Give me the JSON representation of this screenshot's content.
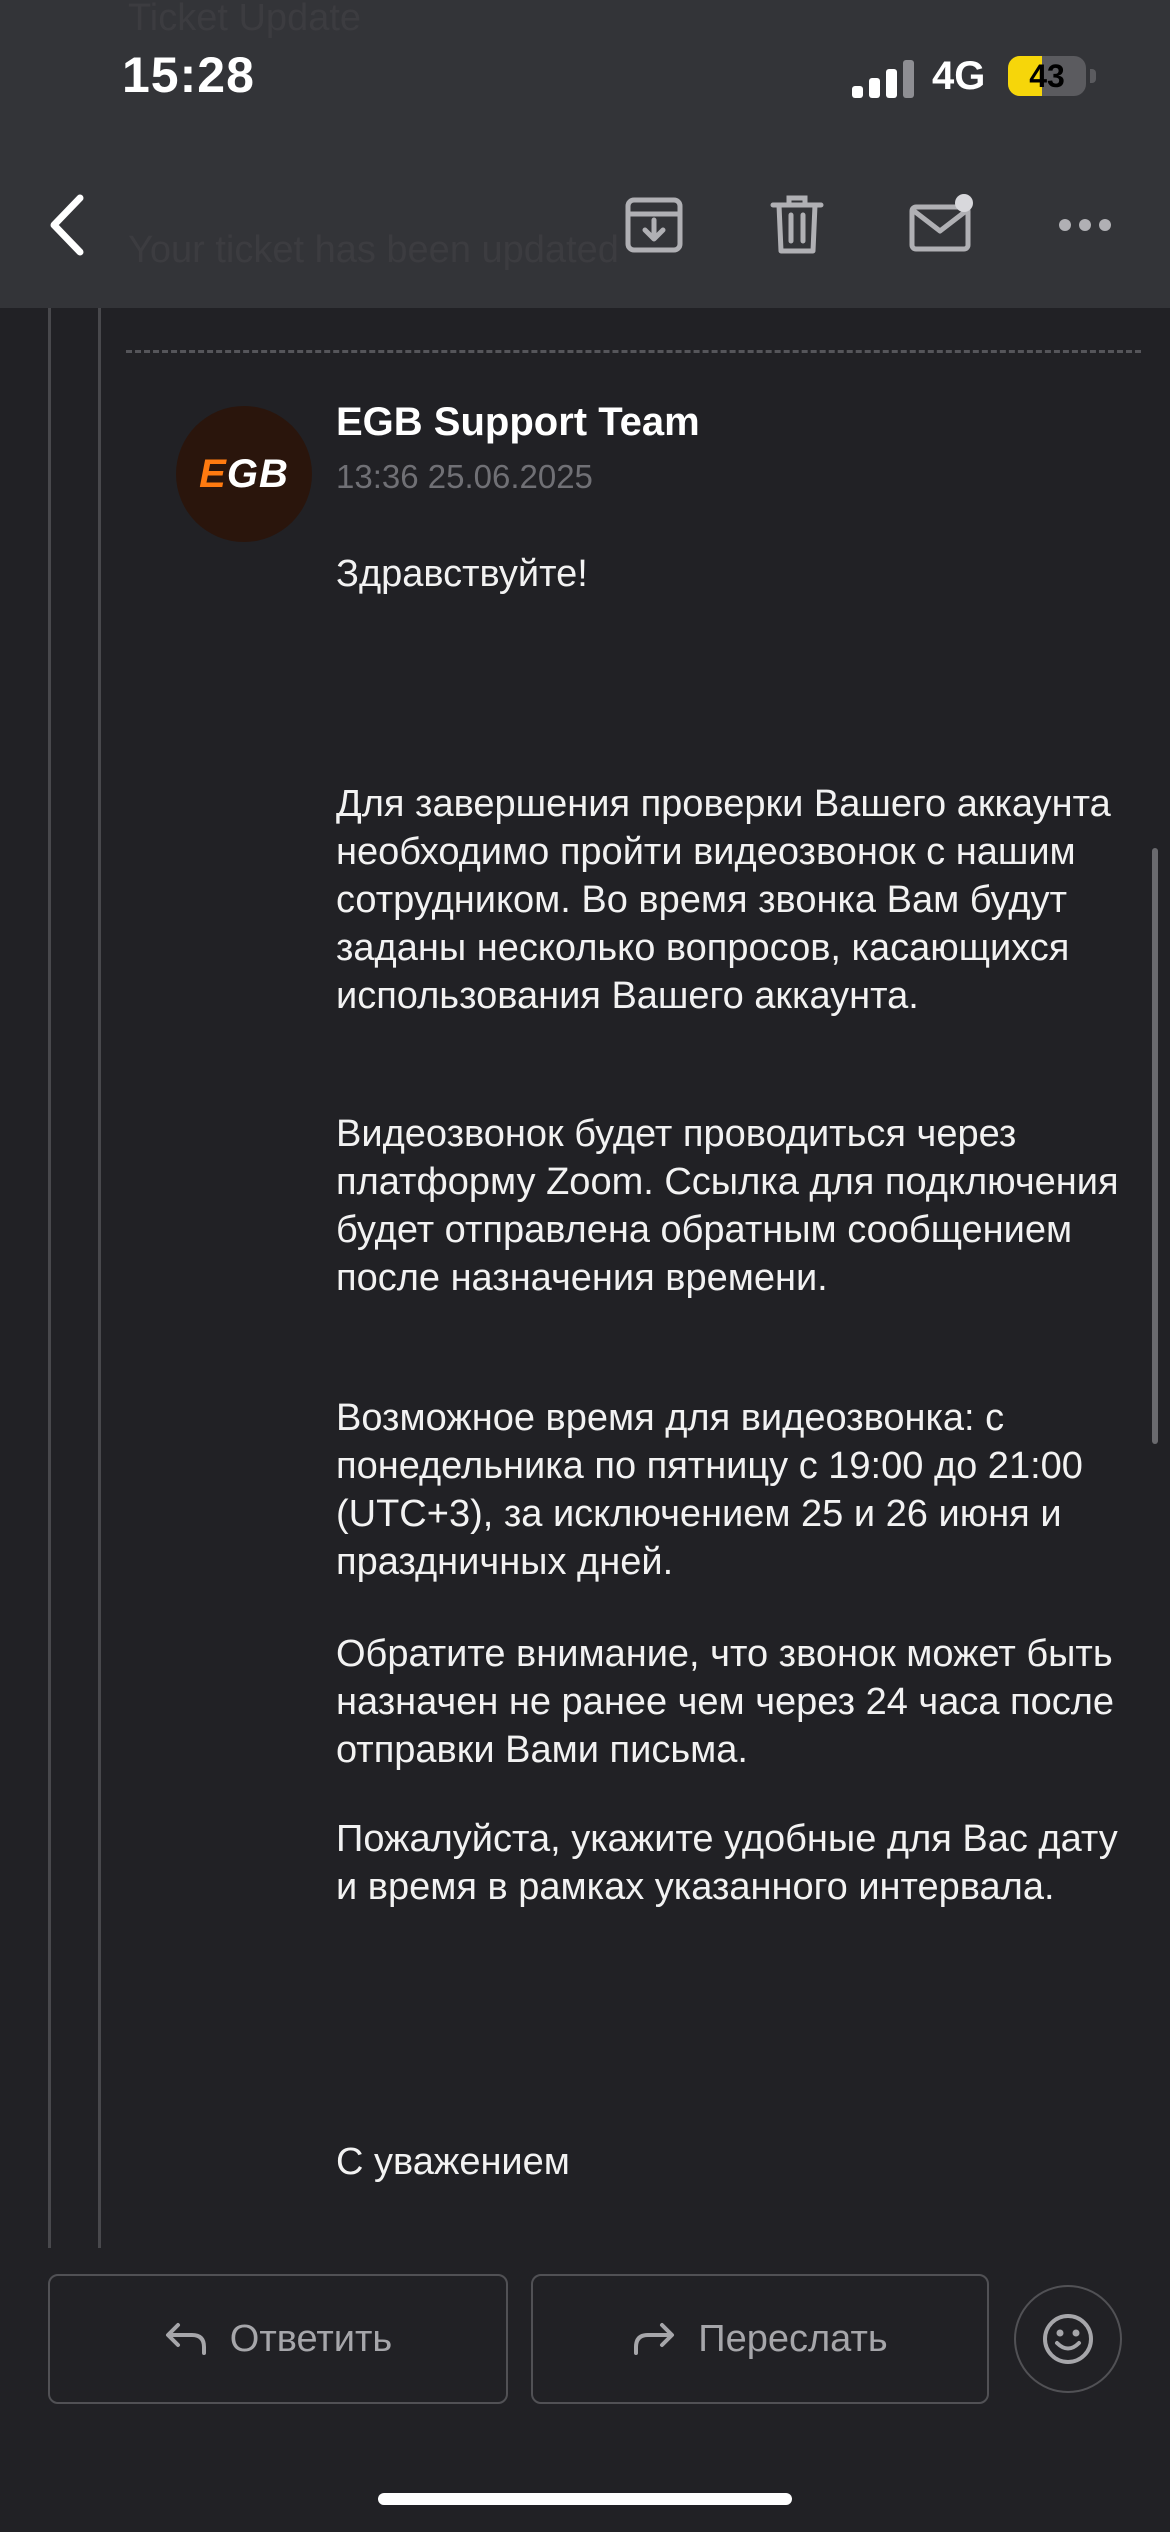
{
  "status_bar": {
    "time": "15:28",
    "network": "4G",
    "battery": "43",
    "battery_level": 0.43
  },
  "background_text": {
    "line1": "Ticket Update",
    "line2": "Your ticket has been updated"
  },
  "header": {
    "icons": [
      "chevron-left-icon",
      "archive-icon",
      "trash-icon",
      "mail-unread-icon",
      "more-icon"
    ]
  },
  "message": {
    "sender": "EGB Support Team",
    "datetime": "13:36 25.06.2025",
    "avatar_text_e": "E",
    "avatar_text_rest": "GB",
    "paragraphs": [
      "Здравствуйте!",
      "Для завершения проверки Вашего аккаунта необходимо пройти видеозвонок с нашим сотрудником. Во время звонка Вам будут заданы несколько вопросов, касающихся использования Вашего аккаунта.",
      "Видеозвонок будет проводиться через платформу Zoom. Ссылка для подключения будет отправлена обратным сообщением после назначения времени.",
      "Возможное время для видеозвонка: с понедельника по пятницу с 19:00 до 21:00 (UTC+3), за исключением 25 и 26 июня и праздничных дней.",
      "Обратите внимание, что звонок может быть назначен не ранее чем через 24 часа после отправки Вами письма.",
      "Пожалуйста, укажите удобные для Вас дату и время в рамках указанного интервала.",
      "С уважением"
    ]
  },
  "actions": {
    "reply": "Ответить",
    "forward": "Переслать"
  },
  "colors": {
    "background": "#212125",
    "header": "#343539",
    "accent_orange": "#ff7a10",
    "battery": "#f6d60a"
  }
}
